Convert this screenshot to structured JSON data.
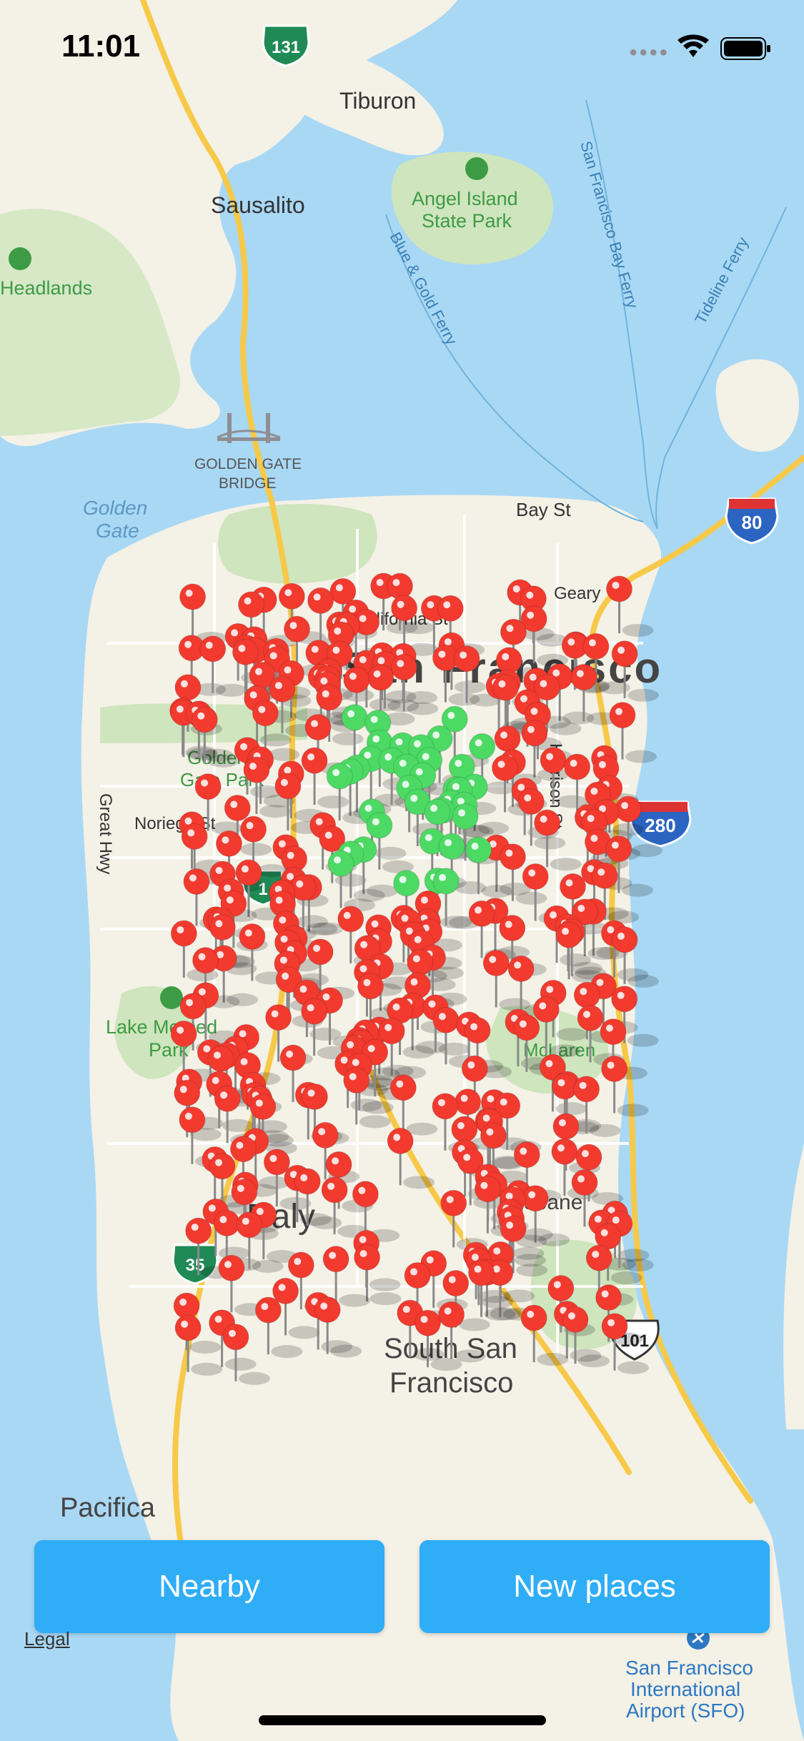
{
  "status_bar": {
    "time": "11:01"
  },
  "map": {
    "water_color": "#a9d8f5",
    "land_color": "#f4f1e6",
    "park_color": "#cfe5bd",
    "road_color": "#f7c948",
    "labels": {
      "tiburon": "Tiburon",
      "sausalito": "Sausalito",
      "angel_island_1": "Angel Island",
      "angel_island_2": "State Park",
      "headlands": "Headlands",
      "golden_gate_bridge_1": "GOLDEN GATE",
      "golden_gate_bridge_2": "BRIDGE",
      "golden_gate_1": "Golden",
      "golden_gate_2": "Gate",
      "bay_st": "Bay St",
      "california_st": "California St",
      "geary": "Geary",
      "san_francisco": "San Francisco",
      "harrison_st": "Harrison St",
      "noriega_st": "Noriega St",
      "great_hwy": "Great Hwy",
      "golden_gate_park_1": "Golden",
      "golden_gate_park_2": "Gate Park",
      "lake_merced_1": "Lake Merced",
      "lake_merced_2": "Park",
      "daly_city": "Daly",
      "brisbane": "Brisbane",
      "south_sf_1": "South San",
      "south_sf_2": "Francisco",
      "pacifica": "Pacifica",
      "sfo_1": "San Francisco",
      "sfo_2": "International",
      "sfo_3": "Airport (SFO)",
      "blue_gold_ferry": "Blue & Gold Ferry",
      "sf_bay_ferry": "San Francisco Bay Ferry",
      "tideline_ferry": "Tideline Ferry",
      "mclaren": "McLaren"
    },
    "shields": {
      "ca131": "131",
      "i80": "80",
      "i280": "280",
      "ca1": "1",
      "ca35": "35",
      "us101": "101"
    },
    "pin_colors": {
      "red": "#f23a2f",
      "green": "#4cd964"
    }
  },
  "buttons": {
    "nearby": "Nearby",
    "new_places": "New places"
  },
  "legal": "Legal"
}
